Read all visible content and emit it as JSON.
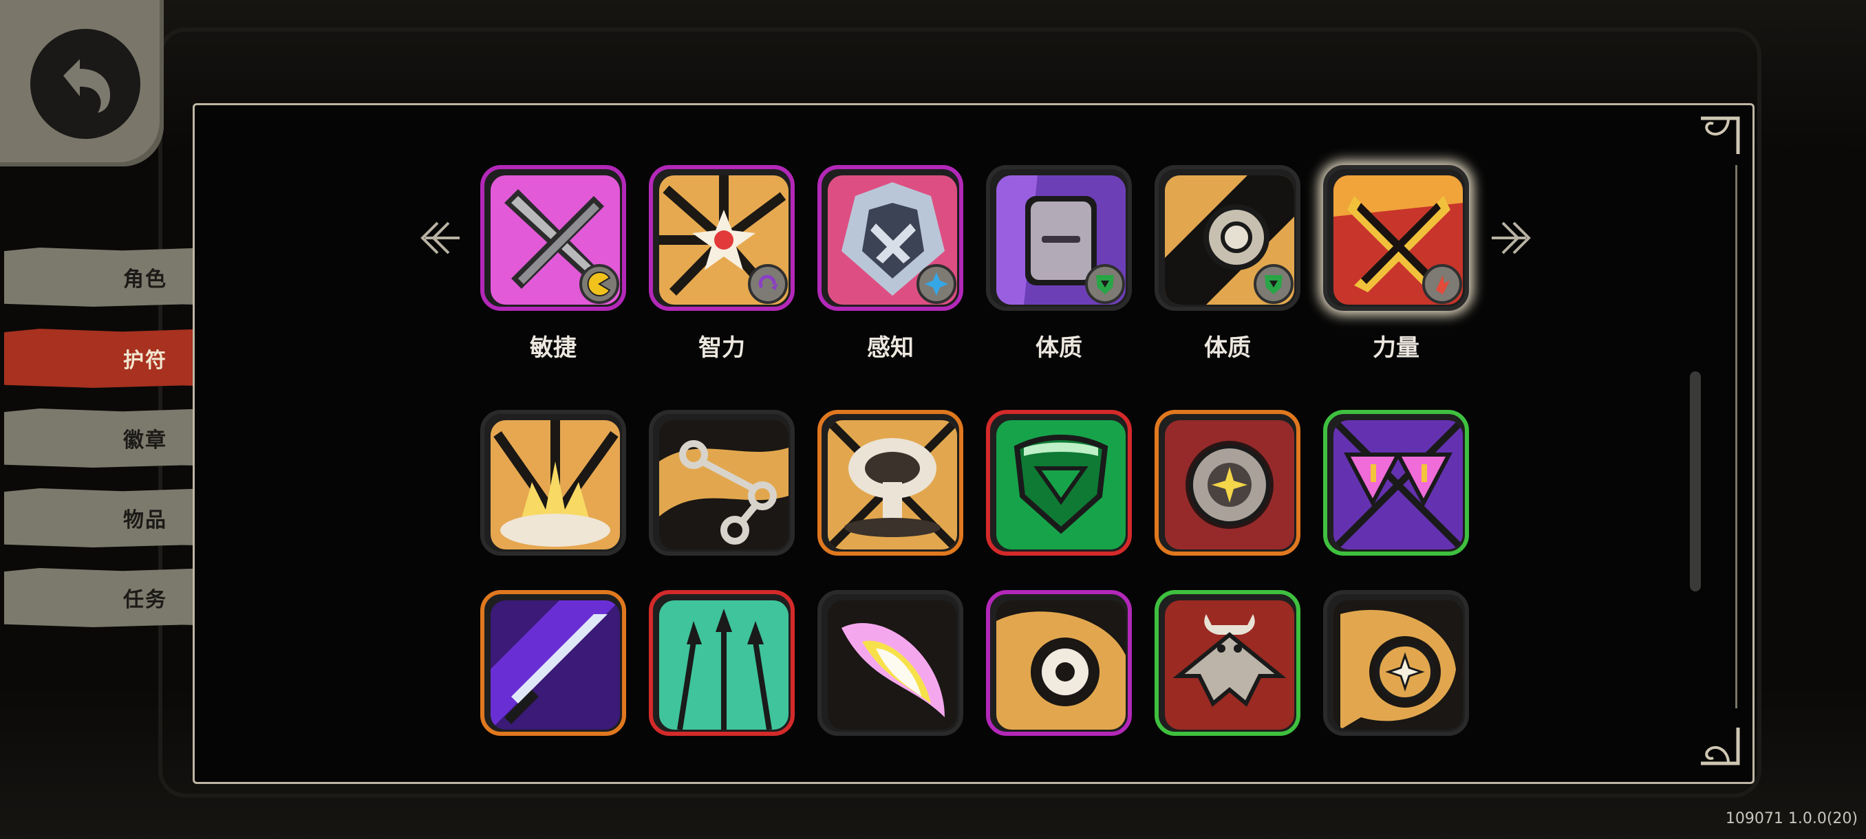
{
  "nav": {
    "back_icon": "back-arrow-icon",
    "tabs": [
      {
        "label": "角色",
        "active": false
      },
      {
        "label": "护符",
        "active": true
      },
      {
        "label": "徽章",
        "active": false
      },
      {
        "label": "物品",
        "active": false
      },
      {
        "label": "任务",
        "active": false
      }
    ]
  },
  "charms": {
    "row1": [
      {
        "label": "敏捷",
        "icon": "crossed-daggers-icon",
        "border": "#b328b8",
        "badge_icon": "pacman-badge-icon"
      },
      {
        "label": "智力",
        "icon": "burst-explosion-icon",
        "border": "#b328b8",
        "badge_icon": "swirl-badge-icon"
      },
      {
        "label": "感知",
        "icon": "armored-wolf-icon",
        "border": "#b328b8",
        "badge_icon": "star-badge-icon"
      },
      {
        "label": "体质",
        "icon": "stone-tablet-icon",
        "border": "#2a2a2a",
        "badge_icon": "shield-badge-icon"
      },
      {
        "label": "体质",
        "icon": "gear-wheel-icon",
        "border": "#2a2a2a",
        "badge_icon": "shield-badge-icon"
      },
      {
        "label": "力量",
        "icon": "flame-cross-icon",
        "border": "#2a2a2a",
        "badge_icon": "fist-badge-icon",
        "selected": true
      }
    ],
    "row2": [
      {
        "icon": "ground-blast-icon",
        "border": "#2a2a2a"
      },
      {
        "icon": "chain-link-icon",
        "border": "#2a2a2a"
      },
      {
        "icon": "mushroom-cloud-icon",
        "border": "#e0781f"
      },
      {
        "icon": "green-shield-icon",
        "border": "#d42a2a"
      },
      {
        "icon": "sun-disk-icon",
        "border": "#e0781f"
      },
      {
        "icon": "triangle-warning-icon",
        "border": "#3fc03f"
      }
    ],
    "row3": [
      {
        "icon": "crystal-blade-icon",
        "border": "#e0781f"
      },
      {
        "icon": "spear-volley-icon",
        "border": "#d42a2a"
      },
      {
        "icon": "glowing-eye-icon",
        "border": "#2a2a2a"
      },
      {
        "icon": "vortex-eye-icon",
        "border": "#b328b8"
      },
      {
        "icon": "horned-demon-icon",
        "border": "#3fc03f"
      },
      {
        "icon": "star-vortex-icon",
        "border": "#2a2a2a"
      }
    ]
  },
  "version": "109071 1.0.0(20)"
}
